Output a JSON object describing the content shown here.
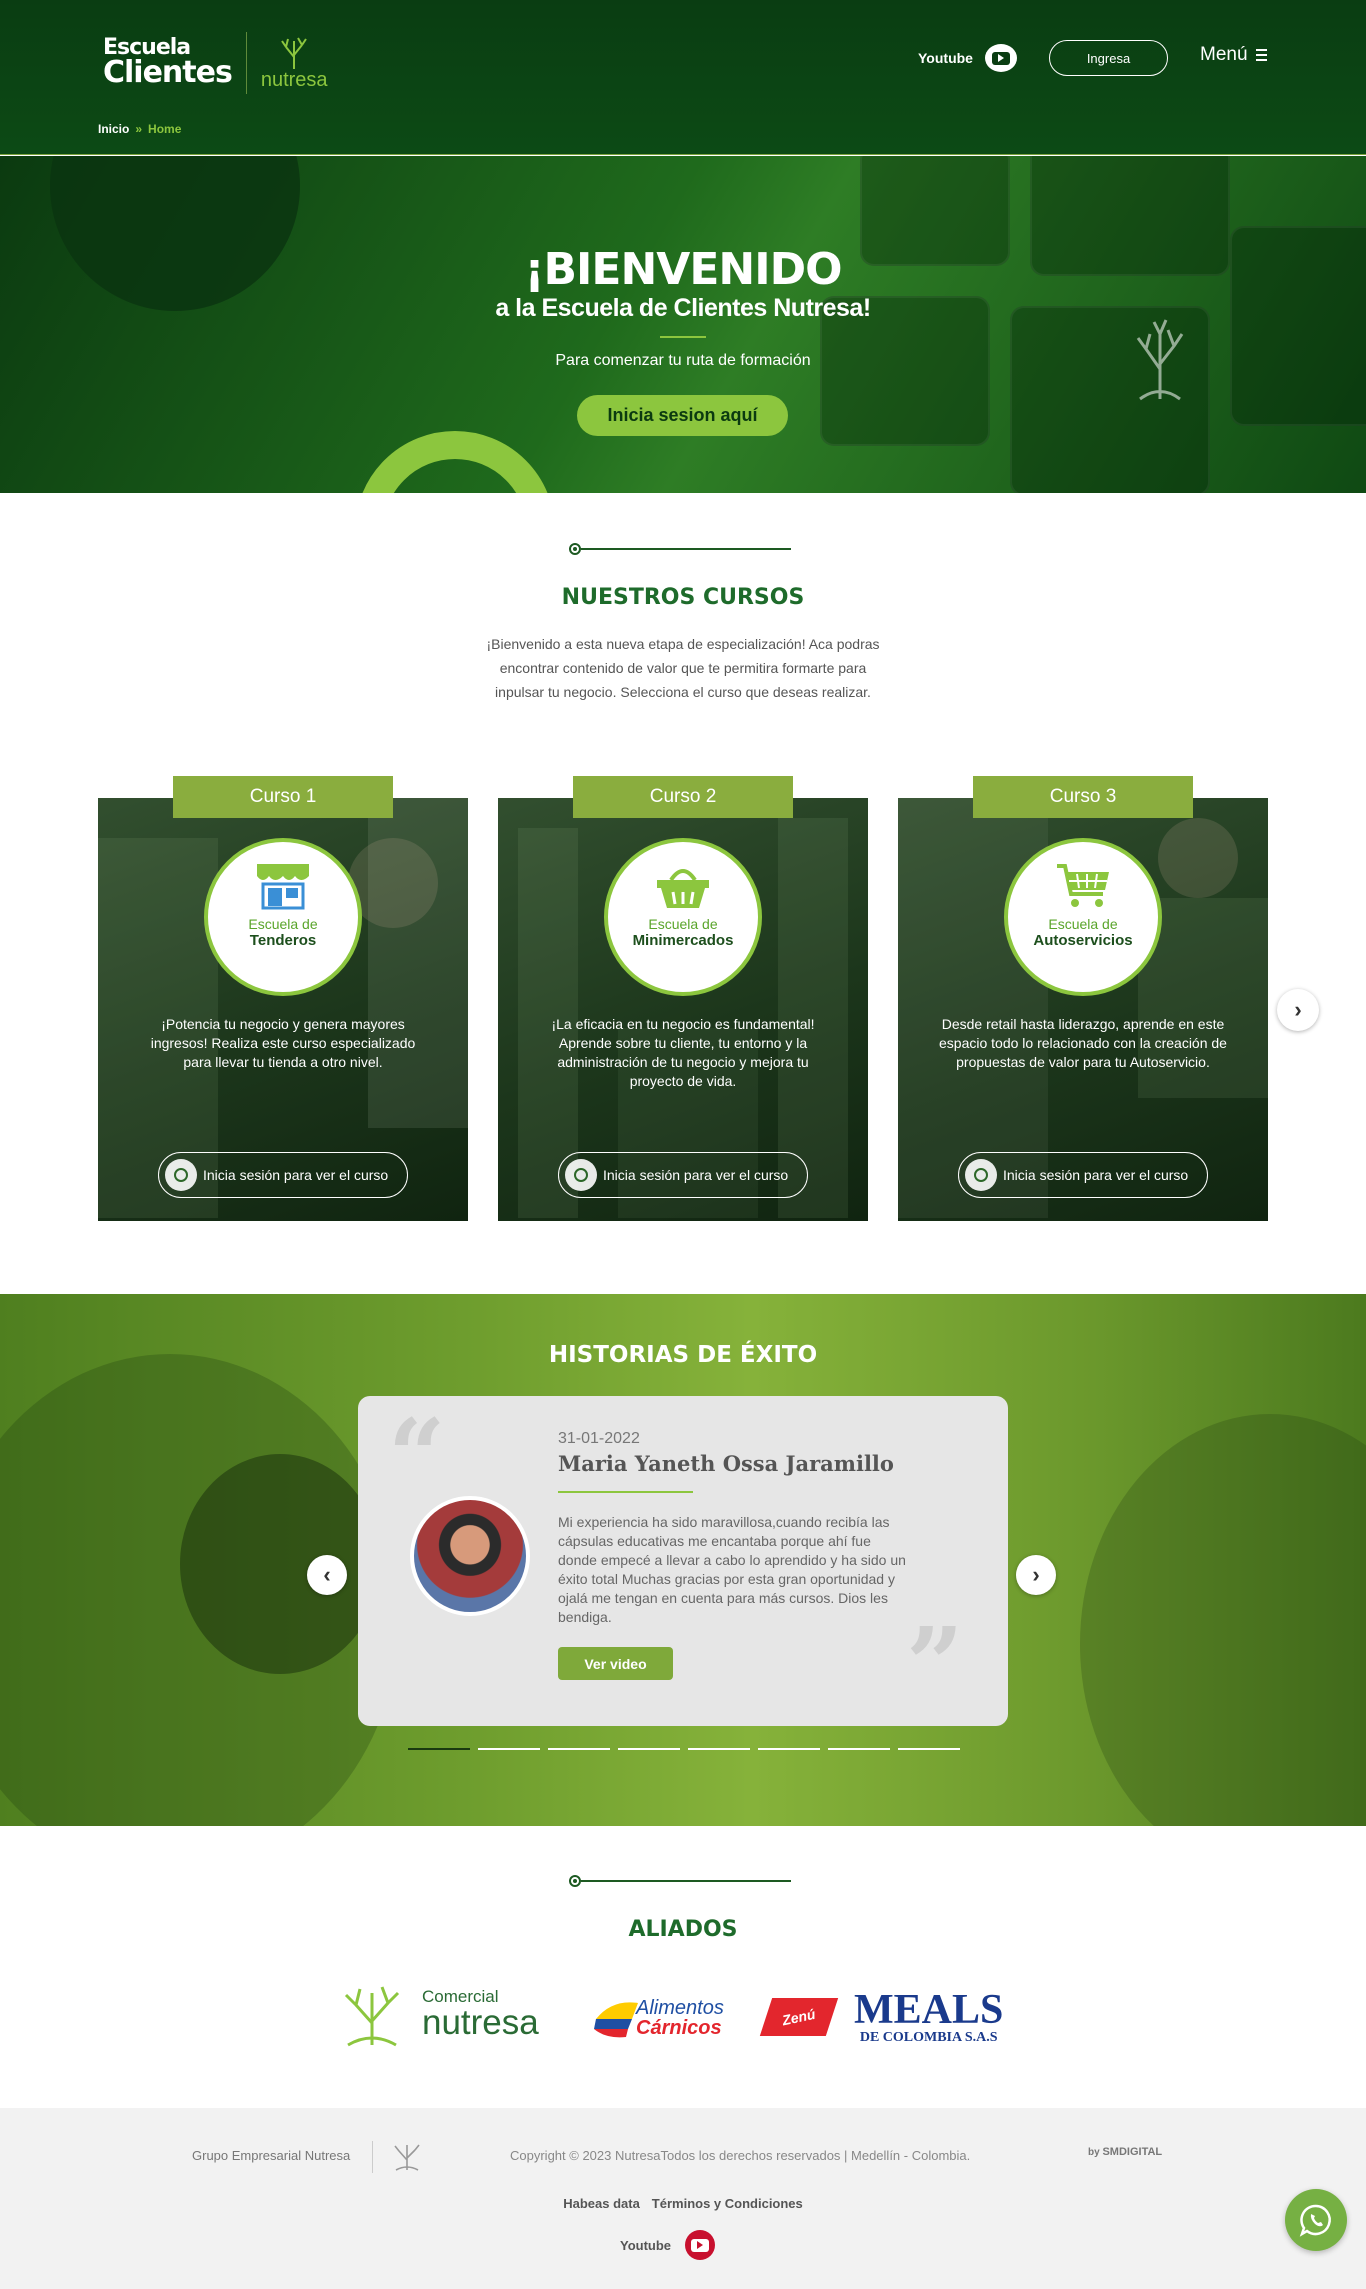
{
  "header": {
    "logo_line1": "Escuela",
    "logo_line2": "Clientes",
    "logo_brand": "nutresa",
    "youtube_label": "Youtube",
    "login_label": "Ingresa",
    "menu_label": "Menú"
  },
  "breadcrumb": {
    "home": "Inicio",
    "separator": "»",
    "current": "Home"
  },
  "hero": {
    "title": "¡BIENVENIDO",
    "subtitle": "a la Escuela de Clientes Nutresa!",
    "text": "Para comenzar tu ruta de formación",
    "cta": "Inicia sesion aquí"
  },
  "courses": {
    "title": "NUESTROS CURSOS",
    "intro": "¡Bienvenido a esta nueva etapa de especialización! Aca podras encontrar contenido de valor que te permitira formarte para inpulsar tu negocio. Selecciona el curso que deseas realizar.",
    "items": [
      {
        "tab": "Curso 1",
        "badge_top": "Escuela de",
        "badge_bottom": "Tenderos",
        "icon": "store-icon",
        "description": "¡Potencia tu negocio y genera mayores ingresos! Realiza este curso especializado para llevar tu tienda a otro nivel.",
        "login": "Inicia sesión para ver el curso"
      },
      {
        "tab": "Curso 2",
        "badge_top": "Escuela de",
        "badge_bottom": "Minimercados",
        "icon": "basket-icon",
        "description": "¡La eficacia en tu negocio es fundamental! Aprende sobre tu cliente, tu entorno y la administración de tu negocio y mejora tu proyecto de vida.",
        "login": "Inicia sesión para ver el curso"
      },
      {
        "tab": "Curso 3",
        "badge_top": "Escuela de",
        "badge_bottom": "Autoservicios",
        "icon": "cart-icon",
        "description": "Desde retail hasta liderazgo, aprende en este espacio todo lo relacionado con la creación de propuestas de valor para tu Autoservicio.",
        "login": "Inicia sesión para ver el curso"
      }
    ]
  },
  "stories": {
    "title": "HISTORIAS DE ÉXITO",
    "date": "31-01-2022",
    "name": "Maria Yaneth Ossa Jaramillo",
    "text": "Mi experiencia ha sido maravillosa,cuando recibía las cápsulas educativas  me encantaba porque ahí fue donde empecé a llevar a cabo lo aprendido y ha sido un éxito total Muchas gracias por esta gran oportunidad y ojalá  me tengan en cuenta para más cursos. Dios les bendiga.",
    "video_button": "Ver video",
    "slide_count": 8,
    "active_slide": 1
  },
  "allies": {
    "title": "ALIADOS",
    "comercial_top": "Comercial",
    "comercial_bottom": "nutresa",
    "alimentos_top": "Alimentos",
    "alimentos_bottom": "Cárnicos",
    "zenu": "Zenú",
    "meals_top": "MEALS",
    "meals_bottom": "DE COLOMBIA S.A.S"
  },
  "footer": {
    "group": "Grupo Empresarial Nutresa",
    "copyright": "Copyright © 2023 NutresaTodos los derechos reservados | Medellín - Colombia.",
    "by": "by",
    "agency": "SMDIGITAL",
    "habeas": "Habeas data",
    "terms": "Términos y Condiciones",
    "youtube": "Youtube"
  },
  "colors": {
    "dark_green": "#0b3a10",
    "accent_green": "#8cc63e",
    "title_green": "#1e6b2b",
    "youtube_red": "#c8102e",
    "whatsapp_green": "#76b043"
  }
}
